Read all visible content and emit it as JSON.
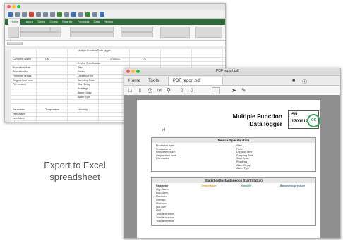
{
  "excel": {
    "tabs": [
      "Home",
      "Layout",
      "Tables",
      "Charts",
      "SmartArt",
      "Formulas",
      "Data",
      "Review"
    ],
    "cells": [
      {
        "t": "Multiple Function Data logger",
        "r": 0,
        "c": 2
      },
      {
        "t": "Company Name",
        "r": 2,
        "c": 0
      },
      {
        "t": "OK",
        "r": 2,
        "c": 1
      },
      {
        "t": "1700012",
        "r": 2,
        "c": 3
      },
      {
        "t": "OK",
        "r": 2,
        "c": 4
      },
      {
        "t": "Device Specification",
        "r": 3,
        "c": 2
      },
      {
        "t": "Production date",
        "r": 4,
        "c": 0
      },
      {
        "t": "Production lot",
        "r": 5,
        "c": 0
      },
      {
        "t": "Firmware version",
        "r": 6,
        "c": 0
      },
      {
        "t": "Original time zone",
        "r": 7,
        "c": 0
      },
      {
        "t": "File created",
        "r": 8,
        "c": 0
      },
      {
        "t": "Start",
        "r": 4,
        "c": 2
      },
      {
        "t": "Finish",
        "r": 5,
        "c": 2
      },
      {
        "t": "Duration Time",
        "r": 6,
        "c": 2
      },
      {
        "t": "Sampling Rate",
        "r": 7,
        "c": 2
      },
      {
        "t": "Start Delay",
        "r": 8,
        "c": 2
      },
      {
        "t": "Readings",
        "r": 9,
        "c": 2
      },
      {
        "t": "Alarm Delay",
        "r": 10,
        "c": 2
      },
      {
        "t": "Alarm Type",
        "r": 11,
        "c": 2
      },
      {
        "t": "Parameter",
        "r": 14,
        "c": 0
      },
      {
        "t": "Temperature",
        "r": 14,
        "c": 1
      },
      {
        "t": "Humidity",
        "r": 14,
        "c": 2
      },
      {
        "t": "High Alarm",
        "r": 15,
        "c": 0
      },
      {
        "t": "Low Alarm",
        "r": 16,
        "c": 0
      },
      {
        "t": "Maximum",
        "r": 17,
        "c": 0
      },
      {
        "t": "Average",
        "r": 18,
        "c": 0
      },
      {
        "t": "Minimum",
        "r": 19,
        "c": 0
      },
      {
        "t": "Std. Dev",
        "r": 20,
        "c": 0
      },
      {
        "t": "MKT",
        "r": 21,
        "c": 0
      }
    ]
  },
  "caption": {
    "line1": "Export to Excel",
    "line2": "spreadsheet"
  },
  "pdf": {
    "window_title": "PDF report.pdf",
    "tabs": {
      "home": "Home",
      "tools": "Tools",
      "doc": "PDF report.pdf"
    },
    "report": {
      "title_line1": "Multiple Function",
      "title_line2": "Data logger",
      "sn_label": "SN",
      "sn_value": "1700012",
      "status": "OK",
      "model": "r4",
      "section1": "Device Specification",
      "section2": "Statistics(Instantaneous Start Status)",
      "spec_left": [
        "Production date",
        "Production lot",
        "Firmware version",
        "Original time zone",
        "File created"
      ],
      "spec_right": [
        "Start",
        "Finish",
        "Duration Time",
        "Sampling Rate",
        "Start Delay",
        "Readings",
        "Alarm Delay",
        "Alarm Type"
      ],
      "stats_rows": [
        "Parameter",
        "High Alarm",
        "Low Alarm",
        "Maximum",
        "Average",
        "Minimum",
        "Std. Dev",
        "MKT",
        "Total time within",
        "Total time above",
        "Total time below"
      ],
      "stats_cols": [
        "Temperature",
        "Humidity",
        "Barometric pressure"
      ]
    }
  },
  "colors": {
    "excel_ribbon": "#2f6b3a",
    "ok_green": "#3aa55a",
    "temperature": "#e89a2a",
    "humidity": "#3aa55a",
    "pressure": "#3f6fb5"
  }
}
